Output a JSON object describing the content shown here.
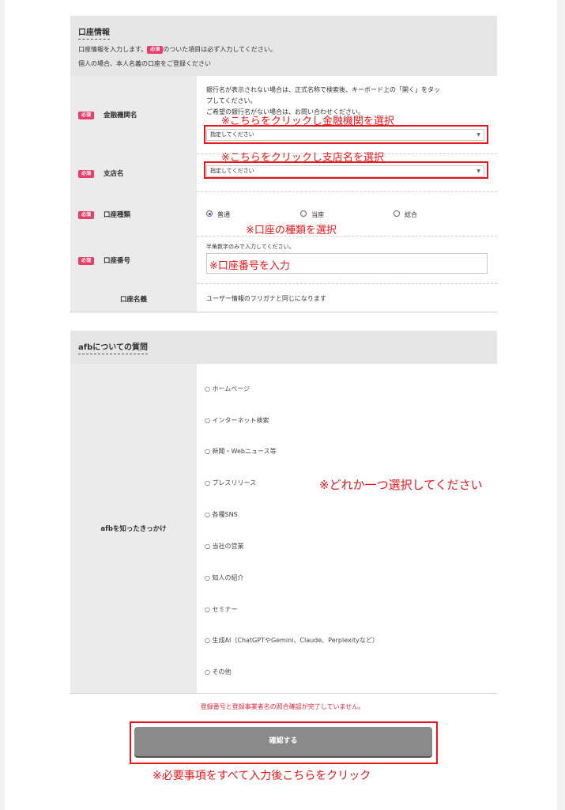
{
  "account": {
    "title": "口座情報",
    "intro_prefix": "口座情報を入力します。",
    "required_badge": "必須",
    "intro_suffix": "のついた項目は必ず入力してください。",
    "intro_line2": "個人の場合、本人名義の口座をご登録ください",
    "bank": {
      "label": "金融機関名",
      "help_line1": "銀行名が表示されない場合は、正式名称で検索後、キーボード上の「開く」をタッ",
      "help_line2": "プしてください。",
      "help_line3": "ご希望の銀行名がない場合は、お問い合わせください。",
      "select_value": "指定してください",
      "annotation": "※こちらをクリックし金融機関を選択"
    },
    "branch": {
      "label": "支店名",
      "select_value": "指定してください",
      "annotation": "※こちらをクリックし支店名を選択"
    },
    "account_type": {
      "label": "口座種類",
      "options": [
        "普通",
        "当座",
        "総合"
      ],
      "selected": "普通",
      "annotation": "※口座の種類を選択"
    },
    "account_number": {
      "label": "口座番号",
      "help": "半角数字のみで入力してください。",
      "annotation": "※口座番号を入力"
    },
    "account_name": {
      "label": "口座名義",
      "value": "ユーザー情報のフリガナと同じになります"
    }
  },
  "afb": {
    "title": "afbについての質問",
    "question_label": "afbを知ったきっかけ",
    "options": [
      "○ ホームページ",
      "○ インターネット検索",
      "○ 新聞・Webニュース等",
      "○ プレスリリース",
      "○ 各種SNS",
      "○ 当社の営業",
      "○ 知人の紹介",
      "○ セミナー",
      "○ 生成AI（ChatGPTやGemini、Claude、Perplexityなど）",
      "○ その他"
    ],
    "annotation": "※どれか一つ選択してください"
  },
  "footer": {
    "warning": "登録番号と登録事業者名の照合確認が完了していません。",
    "confirm_button": "確認する",
    "annotation": "※必要事項をすべて入力後こちらをクリック"
  },
  "colors": {
    "required_badge": "#e83e6c",
    "annotation_red": "#e8161b",
    "warning_red": "#e0283c",
    "button_gray": "#8a8a8a",
    "section_header": "#e6e6e6"
  }
}
